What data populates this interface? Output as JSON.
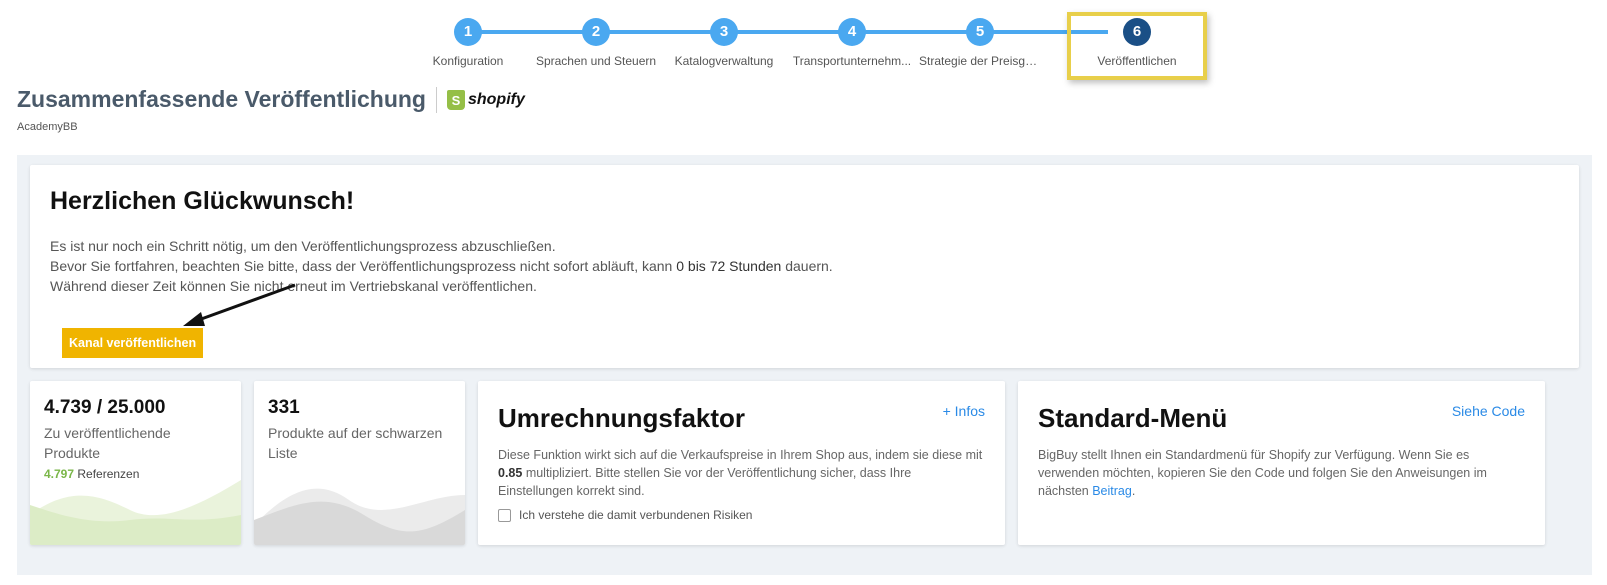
{
  "stepper": {
    "steps": [
      {
        "number": "1",
        "label": "Konfiguration"
      },
      {
        "number": "2",
        "label": "Sprachen und Steuern"
      },
      {
        "number": "3",
        "label": "Katalogverwaltung"
      },
      {
        "number": "4",
        "label": "Transportunternehm..."
      },
      {
        "number": "5",
        "label": "Strategie der Preisge..."
      },
      {
        "number": "6",
        "label": "Veröffentlichen"
      }
    ],
    "active_step": "6"
  },
  "header": {
    "title": "Zusammenfassende Veröffentlichung",
    "brand": "shopify",
    "shop_name": "AcademyBB"
  },
  "congrats": {
    "title": "Herzlichen Glückwunsch!",
    "line1": "Es ist nur noch ein Schritt nötig, um den Veröffentlichungsprozess abzuschließen.",
    "line2_pre": "Bevor Sie fortfahren, beachten Sie bitte, dass der Veröffentlichungsprozess nicht sofort abläuft, kann ",
    "line2_bold": "0 bis 72 Stunden",
    "line2_post": " dauern.",
    "line3": "Während dieser Zeit können Sie nicht erneut im Vertriebskanal veröffentlichen.",
    "button": "Kanal veröffentlichen"
  },
  "stats": {
    "products": {
      "value": "4.739 / 25.000",
      "desc": "Zu veröffentlichende Produkte",
      "refs_count": "4.797",
      "refs_label": " Referenzen"
    },
    "blacklist": {
      "value": "331",
      "desc": "Produkte auf der schwarzen Liste"
    }
  },
  "conversion": {
    "title": "Umrechnungsfaktor",
    "link": "+ Infos",
    "text_pre": "Diese Funktion wirkt sich auf die Verkaufspreise in Ihrem Shop aus, indem sie diese mit ",
    "factor": "0.85",
    "text_post": " multipliziert. Bitte stellen Sie vor der Veröffentlichung sicher, dass Ihre Einstellungen korrekt sind.",
    "checkbox_label": "Ich verstehe die damit verbundenen Risiken"
  },
  "menu": {
    "title": "Standard-Menü",
    "link": "Siehe Code",
    "text": "BigBuy stellt Ihnen ein Standardmenü für Shopify zur Verfügung. Wenn Sie es verwenden möchten, kopieren Sie den Code und folgen Sie den Anweisungen im nächsten ",
    "link_text": "Beitrag",
    "text_end": "."
  },
  "colors": {
    "step": "#4aa8f0",
    "step_active": "#1a4f86",
    "button": "#f0b400",
    "highlight": "#e8cf4a",
    "link": "#2a8ae6",
    "green": "#7ab648"
  }
}
